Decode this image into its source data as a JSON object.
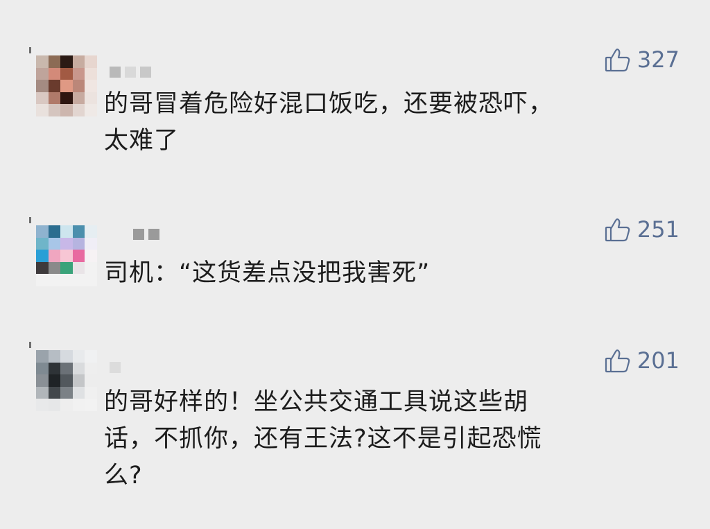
{
  "comments": [
    {
      "likes": "327",
      "text_lines": [
        "的哥冒着危险好混口饭吃，还要被恐吓，",
        "太难了"
      ],
      "avatar_colors": [
        "#c9b8ad",
        "#8c6b55",
        "#2b1a14",
        "#c7aca0",
        "#e7d6cf",
        "#bfa49b",
        "#d38a79",
        "#a25a43",
        "#c9978c",
        "#ede0da",
        "#a48b82",
        "#6a3b2d",
        "#df9984",
        "#bb8779",
        "#f0e6e2",
        "#d9c8c2",
        "#b07a6a",
        "#2e1510",
        "#c7aaa0",
        "#ece3df",
        "#e9e1dd",
        "#d5c5bf",
        "#cdb6ae",
        "#e2d5d0",
        "#efe9e6"
      ]
    },
    {
      "likes": "251",
      "text_lines": [
        "司机：“这货差点没把我害死”"
      ],
      "avatar_colors": [
        "#8fb3cf",
        "#2b6d8f",
        "#cde5ee",
        "#4b8fad",
        "#e6eef2",
        "#6fb5c9",
        "#a8c6e8",
        "#c8b8e8",
        "#b6b4e0",
        "#f0eef6",
        "#2a9fd6",
        "#f0a6c0",
        "#f7c6d4",
        "#e86aa0",
        "#f6f2f4",
        "#3e3a3c",
        "#8a8a8a",
        "#3aa37a",
        "#e9e4e7",
        "#f2f2f2",
        "#f2f2f2",
        "#f2f2f2",
        "#f2f2f2",
        "#f2f2f2",
        "#f2f2f2"
      ]
    },
    {
      "likes": "201",
      "text_lines": [
        "的哥好样的！坐公共交通工具说这些胡",
        "话，不抓你，还有王法?这不是引起恐慌",
        "么?"
      ],
      "avatar_colors": [
        "#9aa3ab",
        "#b6bdc4",
        "#d6dadf",
        "#e8eaec",
        "#f0f1f2",
        "#7f8a92",
        "#2e3337",
        "#6b7177",
        "#d9dbdd",
        "#eeeeee",
        "#8a9096",
        "#1f2326",
        "#52585d",
        "#c4c6c8",
        "#ededed",
        "#b1b6ba",
        "#42474b",
        "#7b8186",
        "#dfe1e3",
        "#f0f0f0",
        "#e8e9ea",
        "#e6e7e8",
        "#eeeeee",
        "#f1f1f1",
        "#f2f2f2"
      ]
    }
  ],
  "colors": {
    "background": "#ededed",
    "text": "#1c1c1c",
    "like": "#5a6f93"
  },
  "icons": {
    "like": "thumbs-up-icon"
  }
}
